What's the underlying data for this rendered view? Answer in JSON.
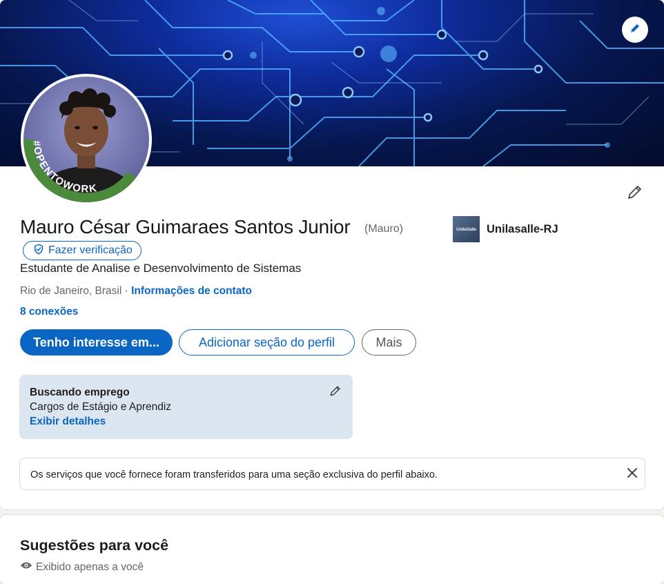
{
  "profile": {
    "name": "Mauro César Guimaraes Santos Junior",
    "nickname": "(Mauro)",
    "verify_label": "Fazer verificação",
    "headline": "Estudante de Analise e Desenvolvimento de Sistemas",
    "location": "Rio de Janeiro, Brasil",
    "location_separator": " · ",
    "contact_link": "Informações de contato",
    "connections": "8 conexões",
    "open_to_work_frame": "#OPENTOWORK",
    "education": {
      "logo_text": "UnilaSalle",
      "name": "Unilasalle-RJ"
    }
  },
  "actions": {
    "primary": "Tenho interesse em...",
    "add_section": "Adicionar seção do perfil",
    "more": "Mais"
  },
  "open_to_work": {
    "title": "Buscando emprego",
    "roles": "Cargos de Estágio e Aprendiz",
    "details_link": "Exibir detalhes"
  },
  "notice": {
    "text": "Os serviços que você fornece foram transferidos para uma seção exclusiva do perfil abaixo."
  },
  "suggestions": {
    "title": "Sugestões para você",
    "visibility": "Exibido apenas a você"
  },
  "colors": {
    "brand_blue": "#0a66c2",
    "open_to_work_green": "#4a8a3a",
    "otw_card_bg": "#dce6f1"
  },
  "icons": {
    "banner_edit": "pencil-icon",
    "profile_edit": "pencil-icon",
    "verify": "shield-check-icon",
    "otw_edit": "pencil-icon",
    "notice_close": "close-icon",
    "visibility": "eye-icon"
  }
}
